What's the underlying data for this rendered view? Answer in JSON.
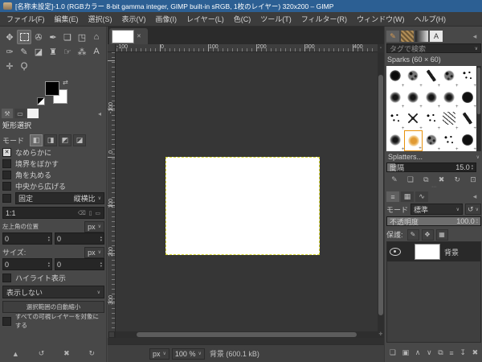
{
  "window": {
    "title": "[名称未設定]-1.0 (RGBカラー 8-bit gamma integer, GIMP built-in sRGB, 1枚のレイヤー) 320x200 – GIMP"
  },
  "icons": {
    "chevron": "∨",
    "close": "✕",
    "check": "✕",
    "swap": "⇄",
    "dots": "⋯",
    "corner_arrow": "◂",
    "nav_cross": "✛",
    "corner_box": "▫",
    "spin_up": "▴",
    "spin_down": "▾",
    "entry_clear": "⌫",
    "entry_portrait": "▯",
    "entry_landscape": "▭"
  },
  "menubar": {
    "items": [
      {
        "name": "file",
        "label": "ファイル(F)"
      },
      {
        "name": "edit",
        "label": "編集(E)"
      },
      {
        "name": "select",
        "label": "選択(S)"
      },
      {
        "name": "view",
        "label": "表示(V)"
      },
      {
        "name": "image",
        "label": "画像(I)"
      },
      {
        "name": "layer",
        "label": "レイヤー(L)"
      },
      {
        "name": "colors",
        "label": "色(C)"
      },
      {
        "name": "tools",
        "label": "ツール(T)"
      },
      {
        "name": "filters",
        "label": "フィルター(R)"
      },
      {
        "name": "windows",
        "label": "ウィンドウ(W)"
      },
      {
        "name": "help",
        "label": "ヘルプ(H)"
      }
    ]
  },
  "toolbox": {
    "tools": [
      {
        "name": "move",
        "glyph": "✥"
      },
      {
        "name": "rectangle-select",
        "glyph": "",
        "box": true,
        "active": true
      },
      {
        "name": "free-select",
        "glyph": "✇"
      },
      {
        "name": "paths",
        "glyph": "✒"
      },
      {
        "name": "crop",
        "glyph": "❏"
      },
      {
        "name": "transform",
        "glyph": "◳"
      },
      {
        "name": "warp-transform",
        "glyph": "⌂"
      },
      {
        "name": "ink",
        "glyph": "✑"
      },
      {
        "name": "pencil",
        "glyph": "✎"
      },
      {
        "name": "eraser",
        "glyph": "◪"
      },
      {
        "name": "clone",
        "glyph": "♜"
      },
      {
        "name": "smudge",
        "glyph": "☞"
      },
      {
        "name": "airbrush",
        "glyph": "⁂"
      },
      {
        "name": "text",
        "glyph": "A"
      },
      {
        "name": "color-picker",
        "glyph": "✛"
      },
      {
        "name": "zoom",
        "glyph": "Ϙ"
      }
    ],
    "foreground_color": "#000000",
    "background_color": "#ffffff"
  },
  "left_dock_tabs": [
    {
      "name": "tool-options",
      "glyph": "⚒",
      "active": true
    },
    {
      "name": "device-status",
      "glyph": "▭"
    },
    {
      "name": "fg-color",
      "glyph": "",
      "cls": "white-swatch"
    }
  ],
  "tool_options": {
    "title": "矩形選択",
    "mode_label": "モード",
    "mode_buttons": [
      {
        "name": "mode-replace",
        "glyph": "◧",
        "active": true
      },
      {
        "name": "mode-add",
        "glyph": "◨"
      },
      {
        "name": "mode-subtract",
        "glyph": "◩"
      },
      {
        "name": "mode-intersect",
        "glyph": "◪"
      }
    ],
    "checkboxes": [
      {
        "name": "antialiasing",
        "label": "なめらかに",
        "checked": true
      },
      {
        "name": "feather-edges",
        "label": "境界をぼかす",
        "checked": false
      },
      {
        "name": "rounded-corners",
        "label": "角を丸める",
        "checked": false
      },
      {
        "name": "expand-from-center",
        "label": "中央から広げる",
        "checked": false
      }
    ],
    "fixed_checked": false,
    "fixed_label": "固定",
    "fixed_value": "縦横比",
    "ratio_value": "1:1",
    "position_label": "左上角の位置",
    "position_unit": "px",
    "position_x": "0",
    "position_y": "0",
    "size_label": "サイズ:",
    "size_unit": "px",
    "size_w": "0",
    "size_h": "0",
    "highlight_label": "ハイライト表示",
    "highlight_checked": false,
    "guides_dropdown": "表示しない",
    "shrink_button": "選択範囲の自動縮小",
    "sample_merged_label": "すべての可視レイヤーを対象にする",
    "sample_merged_checked": false,
    "footer_buttons": [
      {
        "name": "save-tool-preset",
        "glyph": "▲"
      },
      {
        "name": "restore-tool-preset",
        "glyph": "↺"
      },
      {
        "name": "delete-tool-preset",
        "glyph": "✖"
      },
      {
        "name": "reset-tool-options",
        "glyph": "↻"
      }
    ]
  },
  "canvas": {
    "h_ruler_labels": [
      "-100",
      "0",
      "100",
      "200",
      "300",
      "400"
    ],
    "v_ruler_labels": [
      "-100",
      "0",
      "100",
      "200",
      "300"
    ],
    "status": {
      "unit": "px",
      "zoom": "100 %",
      "message": "背景 (600.1 kB)"
    }
  },
  "brushes_dock": {
    "tabs": [
      {
        "name": "brushes",
        "glyph": "✎",
        "active": true
      },
      {
        "name": "patterns",
        "glyph": "",
        "cls": "checker"
      },
      {
        "name": "gradients",
        "glyph": "",
        "cls": "grad"
      },
      {
        "name": "fonts",
        "glyph": "A",
        "cls": "page"
      }
    ],
    "filter_placeholder": "タグで検索",
    "selected_brush": "Sparks (60 × 60)",
    "cells": [
      "b-blob",
      "b-spray",
      "b-streak",
      "b-spray",
      "b-dots",
      "b-splat",
      "b-splat",
      "b-splat",
      "b-splat",
      "b-disc",
      "b-dots",
      "b-star",
      "b-dots",
      "b-lines",
      "b-streak",
      "b-splat",
      "b-orange",
      "b-spray",
      "b-dots",
      "b-disc"
    ],
    "selected_cell_index": 16,
    "list_footer": "Splatters...",
    "spacing_label": "間隔",
    "spacing_value": "15.0",
    "buttons": [
      {
        "name": "edit-brush",
        "glyph": "✎"
      },
      {
        "name": "new-brush",
        "glyph": "❏"
      },
      {
        "name": "duplicate-brush",
        "glyph": "⧉"
      },
      {
        "name": "delete-brush",
        "glyph": "✖"
      },
      {
        "name": "refresh-brushes",
        "glyph": "↻"
      },
      {
        "name": "open-brush-as-image",
        "glyph": "⊡"
      }
    ]
  },
  "layers_dock": {
    "tabs": [
      {
        "name": "layers",
        "glyph": "≡",
        "active": true
      },
      {
        "name": "channels",
        "glyph": "▦"
      },
      {
        "name": "paths",
        "glyph": "∿"
      }
    ],
    "mode_label": "モード",
    "mode_value": "標準",
    "opacity_label": "不透明度",
    "opacity_value": "100.0",
    "opacity_percent": 100,
    "lock_label": "保護:",
    "lock_buttons": [
      {
        "name": "lock-pixels",
        "glyph": "✎"
      },
      {
        "name": "lock-position",
        "glyph": "✥"
      },
      {
        "name": "lock-alpha",
        "glyph": "▦"
      }
    ],
    "layers": [
      {
        "name": "背景",
        "visible": true,
        "selected": true
      }
    ],
    "buttons": [
      {
        "name": "new-layer",
        "glyph": "❏"
      },
      {
        "name": "new-layer-group",
        "glyph": "▣"
      },
      {
        "name": "raise-layer",
        "glyph": "∧"
      },
      {
        "name": "lower-layer",
        "glyph": "∨"
      },
      {
        "name": "duplicate-layer",
        "glyph": "⧉"
      },
      {
        "name": "merge-layer",
        "glyph": "≡"
      },
      {
        "name": "anchor-layer",
        "glyph": "↧"
      },
      {
        "name": "delete-layer",
        "glyph": "✖"
      }
    ]
  }
}
